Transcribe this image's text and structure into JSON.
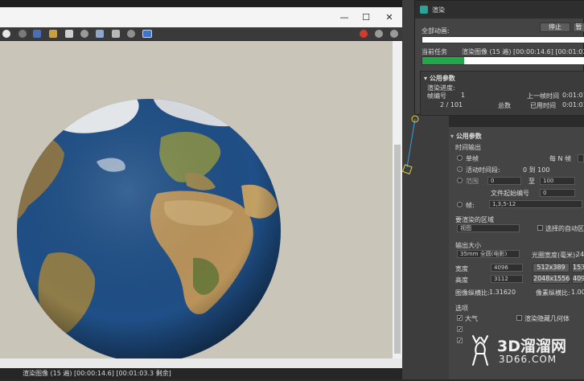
{
  "frame_window": {
    "controls": {
      "minimize": "—",
      "maximize": "☐",
      "close": "✕"
    },
    "status_text": "渲染图像 (15 遍) [00:00:14.6] [00:01:03.3 剩余]"
  },
  "dialog": {
    "title": "渲染",
    "all_anim_label": "全部动画:",
    "stop_label": "停止",
    "pause_label": "暂",
    "current_task_label": "当前任务",
    "current_task_value": "渲染图像 (15 遍) [00:00:14.6] [00:01:03.",
    "progress_fraction": 0.26,
    "params_header": "公用参数",
    "render_progress_label": "渲染进度:",
    "frame_number_label": "帧编号",
    "frame_number_value": "1",
    "frame_count_value": "2 / 101",
    "total_label": "总数",
    "last_frame_time_label": "上一帧时间",
    "last_frame_time_value": "0:01:01",
    "elapsed_label": "已用时间",
    "elapsed_value": "0:01:01"
  },
  "params": {
    "header": "公用参数",
    "time_output_label": "时间输出",
    "single_label": "单帧",
    "every_n_label": "每 N 帧",
    "active_segment_label": "活动时间段:",
    "active_segment_value": "0 到 100",
    "range_label": "范围",
    "range_from": "0",
    "range_to_label": "至",
    "range_to": "100",
    "file_start_label": "文件起始编号",
    "file_start_value": "0",
    "frames_label": "帧:",
    "frames_value": "1,3,5-12",
    "area_label": "要渲染的区域",
    "area_value": "视图",
    "auto_region_label": "选择的自动区",
    "output_size_label": "输出大小",
    "size_preset": "35mm 全圆(电影)",
    "aperture_label": "光圈宽度(毫米):",
    "aperture_value": "24",
    "width_label": "宽度",
    "width_value": "4096",
    "height_label": "高度",
    "height_value": "3112",
    "preset1": "512x389",
    "preset2": "1536",
    "preset3": "2048x1556",
    "preset4": "4096",
    "image_aspect_label": "图像纵横比:",
    "image_aspect_value": "1.31620",
    "pixel_aspect_label": "像素纵横比:",
    "pixel_aspect_value": "1.000",
    "options_label": "选项",
    "atmosphere_label": "大气",
    "render_hidden_label": "渲染隐藏几何体"
  },
  "watermark": {
    "line1": "3D溜溜网",
    "line2": "3D66.COM"
  },
  "colors": {
    "progress_green": "#22a84b",
    "canvas_bg": "#c9c5b8",
    "ocean": "#1f4f86",
    "land": "#a8864f"
  }
}
